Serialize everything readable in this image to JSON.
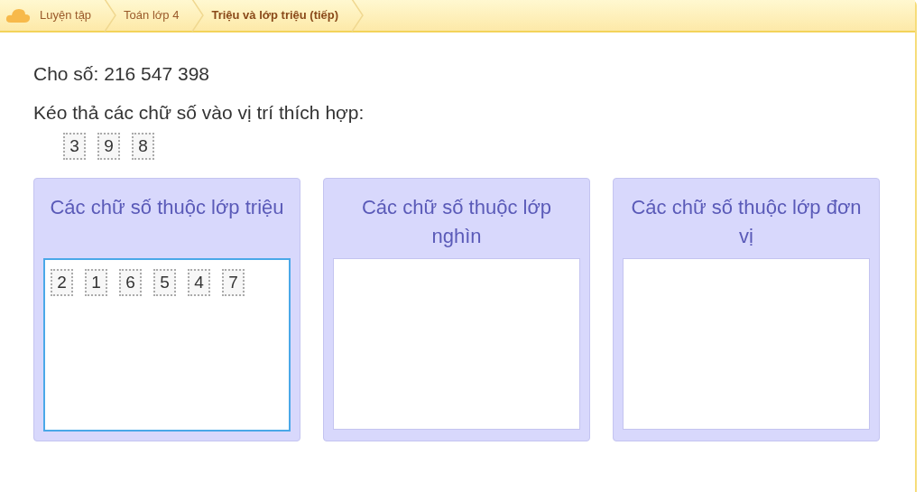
{
  "breadcrumb": [
    {
      "label": "Luyện tập",
      "selected": false
    },
    {
      "label": "Toán lớp 4",
      "selected": false
    },
    {
      "label": "Triệu và lớp triệu (tiếp)",
      "selected": true
    }
  ],
  "question": "Cho số: 216 547 398",
  "instruction": "Kéo thả các chữ số vào vị trí thích hợp:",
  "source_digits": [
    "3",
    "9",
    "8"
  ],
  "zones": [
    {
      "title": "Các chữ số thuộc lớp triệu",
      "selected": true,
      "digits": [
        "2",
        "1",
        "6",
        "5",
        "4",
        "7"
      ]
    },
    {
      "title": "Các chữ số thuộc lớp nghìn",
      "selected": false
    },
    {
      "title": "Các chữ số thuộc lớp đơn vị",
      "selected": false
    }
  ]
}
